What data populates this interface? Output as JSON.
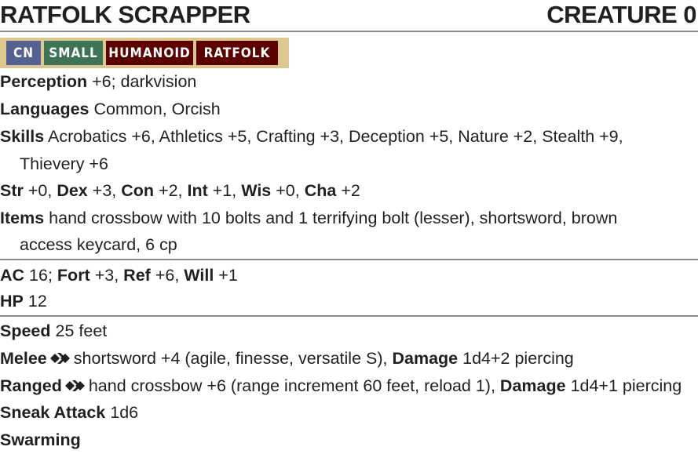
{
  "header": {
    "name": "RATFOLK SCRAPPER",
    "level": "CREATURE 0"
  },
  "traits": [
    {
      "label": "CN",
      "color": "#566193"
    },
    {
      "label": "SMALL",
      "color": "#3e7456"
    },
    {
      "label": "HUMANOID",
      "color": "#5d0000"
    },
    {
      "label": "RATFOLK",
      "color": "#5d0000"
    }
  ],
  "perception": {
    "label": "Perception",
    "value": "+6; darkvision"
  },
  "languages": {
    "label": "Languages",
    "value": "Common, Orcish"
  },
  "skills": {
    "label": "Skills",
    "line1": "Acrobatics +6, Athletics +5, Crafting +3, Deception +5, Nature +2, Stealth +9,",
    "line2": "Thievery +6"
  },
  "abilities": [
    {
      "label": "Str",
      "value": "+0"
    },
    {
      "label": "Dex",
      "value": "+3"
    },
    {
      "label": "Con",
      "value": "+2"
    },
    {
      "label": "Int",
      "value": "+1"
    },
    {
      "label": "Wis",
      "value": "+0"
    },
    {
      "label": "Cha",
      "value": "+2"
    }
  ],
  "items": {
    "label": "Items",
    "line1": "hand crossbow with 10 bolts and 1 terrifying bolt (lesser), shortsword, brown",
    "line2": "access keycard, 6 cp"
  },
  "defense": {
    "ac_label": "AC",
    "ac": "16",
    "fort_label": "Fort",
    "fort": "+3",
    "ref_label": "Ref",
    "ref": "+6",
    "will_label": "Will",
    "will": "+1"
  },
  "hp": {
    "label": "HP",
    "value": "12"
  },
  "speed": {
    "label": "Speed",
    "value": "25 feet"
  },
  "melee": {
    "label": "Melee",
    "icon": "single-action-icon",
    "text": "shortsword +4 (agile, finesse, versatile S),",
    "damage_label": "Damage",
    "damage": "1d4+2 piercing"
  },
  "ranged": {
    "label": "Ranged",
    "icon": "single-action-icon",
    "text": "hand crossbow +6 (range increment 60 feet, reload 1),",
    "damage_label": "Damage",
    "damage": "1d4+1 piercing"
  },
  "sneak_attack": {
    "label": "Sneak Attack",
    "value": "1d6"
  },
  "swarming": {
    "label": "Swarming"
  }
}
